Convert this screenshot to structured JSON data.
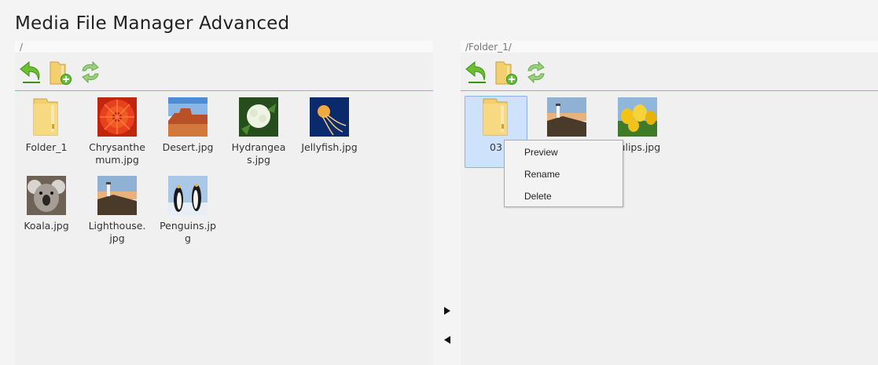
{
  "app": {
    "title": "Media File Manager Advanced"
  },
  "left_pane": {
    "path": "/",
    "items": [
      {
        "label": "Folder_1",
        "type": "folder"
      },
      {
        "label": "Chrysanthemum.jpg",
        "type": "image"
      },
      {
        "label": "Desert.jpg",
        "type": "image"
      },
      {
        "label": "Hydrangeas.jpg",
        "type": "image"
      },
      {
        "label": "Jellyfish.jpg",
        "type": "image"
      },
      {
        "label": "Koala.jpg",
        "type": "image"
      },
      {
        "label": "Lighthouse.jpg",
        "type": "image"
      },
      {
        "label": "Penguins.jpg",
        "type": "image"
      }
    ]
  },
  "right_pane": {
    "path": "/Folder_1/",
    "items": [
      {
        "label": "03",
        "type": "folder",
        "selected": true
      },
      {
        "label": "",
        "type": "image"
      },
      {
        "label": "Tulips.jpg",
        "type": "image"
      }
    ]
  },
  "toolbar": {
    "icons": [
      "back-icon",
      "new-folder-icon",
      "refresh-icon"
    ]
  },
  "context_menu": {
    "items": [
      "Preview",
      "Rename",
      "Delete"
    ]
  },
  "colors": {
    "accent_line": "#59c7d6",
    "selection": "#cfe2fb",
    "folder": "#f3cf6d"
  }
}
